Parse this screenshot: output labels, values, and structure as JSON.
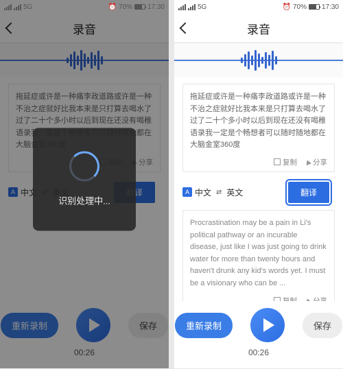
{
  "status": {
    "sim": "5G",
    "alarm": "⏰",
    "battery": "70%",
    "time": "17:30"
  },
  "header": {
    "title": "录音"
  },
  "transcript": {
    "text_cn": "拖延症或许是一种痛李政道路或许是一种不治之症就好比我本来是只打算去喝水了过了二十个多小时以后到现在还没有喝稚语录我一定是个畅想者可以随时随地都在大脑金室360度"
  },
  "actions": {
    "copy": "复制",
    "share": "分享"
  },
  "lang": {
    "from": "中文",
    "to": "英文",
    "translate_btn": "翻译",
    "badge": "A"
  },
  "translation": {
    "text_en": "Procrastination may be a pain in Li's political pathway or an incurable disease, just like I was just going to drink water for more than twenty hours and haven't drunk any kid's words yet. I must be a visionary who can be ..."
  },
  "controls": {
    "rerecord": "重新录制",
    "save": "保存",
    "time": "00:26"
  },
  "modal": {
    "processing": "识别处理中..."
  }
}
